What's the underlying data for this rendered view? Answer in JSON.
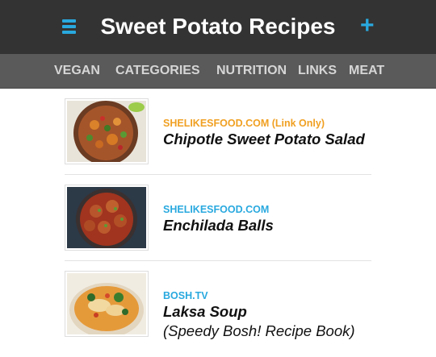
{
  "header": {
    "title": "Sweet Potato Recipes",
    "menu_icon": "hamburger-menu-icon",
    "add_icon": "plus-icon",
    "add_label": "+"
  },
  "nav": {
    "items": [
      "VEGAN",
      "CATEGORIES",
      "NUTRITION",
      "LINKS",
      "MEAT"
    ]
  },
  "recipes": [
    {
      "source": "SHELIKESFOOD.COM (Link Only)",
      "name": "Chipotle Sweet Potato Salad",
      "subtitle": "",
      "source_color": "#f0a022"
    },
    {
      "source": "SHELIKESFOOD.COM",
      "name": "Enchilada Balls",
      "subtitle": "",
      "source_color": "#29a9df"
    },
    {
      "source": "BOSH.TV",
      "name": "Laksa Soup",
      "subtitle": "(Speedy Bosh! Recipe Book)",
      "source_color": "#29a9df"
    }
  ],
  "colors": {
    "header_bg": "#333333",
    "nav_bg": "#5a5a5a",
    "accent": "#29a9df",
    "orange": "#f0a022"
  }
}
